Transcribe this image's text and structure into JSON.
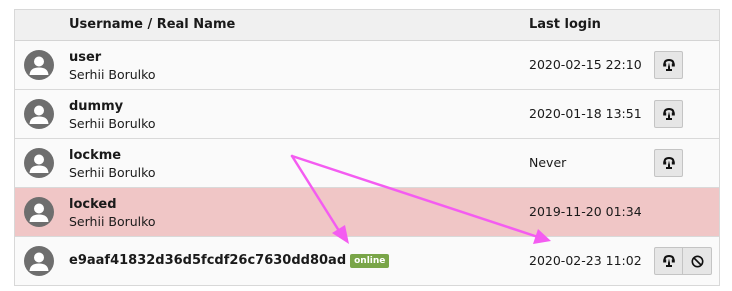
{
  "table": {
    "headers": {
      "user": "Username / Real Name",
      "login": "Last login"
    },
    "rows": [
      {
        "username": "user",
        "realname": "Serhii Borulko",
        "last_login": "2020-02-15 22:10",
        "locked": false,
        "actions": [
          "switch-user"
        ]
      },
      {
        "username": "dummy",
        "realname": "Serhii Borulko",
        "last_login": "2020-01-18 13:51",
        "locked": false,
        "actions": [
          "switch-user"
        ]
      },
      {
        "username": "lockme",
        "realname": "Serhii Borulko",
        "last_login": "Never",
        "locked": false,
        "actions": [
          "switch-user"
        ]
      },
      {
        "username": "locked",
        "realname": "Serhii Borulko",
        "last_login": "2019-11-20 01:34",
        "locked": true,
        "actions": []
      },
      {
        "username": "e9aaf41832d36d5fcdf26c7630dd80ad",
        "badge": "online",
        "last_login": "2020-02-23 11:02",
        "locked": false,
        "actions": [
          "switch-user",
          "lock-user"
        ]
      }
    ]
  },
  "colors": {
    "locked_row": "#f0c6c6",
    "online_badge": "#79a548",
    "annotation_arrow": "#f45cf1"
  },
  "icons": {
    "avatar": "user-avatar-icon",
    "switch_user": "switch-user-icon",
    "lock_user": "block-icon"
  }
}
